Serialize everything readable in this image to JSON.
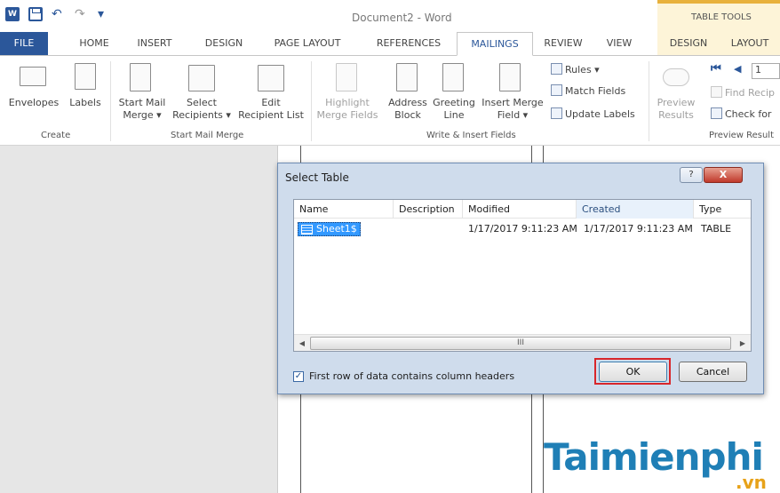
{
  "titlebar": {
    "doc_title": "Document2 - Word",
    "context_tab_header": "TABLE TOOLS"
  },
  "tabs": [
    {
      "label": "FILE"
    },
    {
      "label": "HOME"
    },
    {
      "label": "INSERT"
    },
    {
      "label": "DESIGN"
    },
    {
      "label": "PAGE LAYOUT"
    },
    {
      "label": "REFERENCES"
    },
    {
      "label": "MAILINGS"
    },
    {
      "label": "REVIEW"
    },
    {
      "label": "VIEW"
    },
    {
      "label": "DESIGN"
    },
    {
      "label": "LAYOUT"
    }
  ],
  "ribbon": {
    "create": {
      "label": "Create",
      "envelopes": "Envelopes",
      "labels": "Labels"
    },
    "start_mail_merge": {
      "label": "Start Mail Merge",
      "start_line1": "Start Mail",
      "start_line2": "Merge ▾",
      "select_line1": "Select",
      "select_line2": "Recipients ▾",
      "edit_line1": "Edit",
      "edit_line2": "Recipient List"
    },
    "write_insert": {
      "label": "Write & Insert Fields",
      "highlight_line1": "Highlight",
      "highlight_line2": "Merge Fields",
      "address_line1": "Address",
      "address_line2": "Block",
      "greeting_line1": "Greeting",
      "greeting_line2": "Line",
      "insert_line1": "Insert Merge",
      "insert_line2": "Field ▾",
      "rules": "Rules ▾",
      "match_fields": "Match Fields",
      "update_labels": "Update Labels"
    },
    "preview": {
      "label": "Preview Result",
      "preview_line1": "Preview",
      "preview_line2": "Results",
      "record_value": "1",
      "find_recipient": "Find Recip",
      "check_for": "Check for"
    }
  },
  "dialog": {
    "title": "Select Table",
    "help": "?",
    "close": "X",
    "columns": [
      "Name",
      "Description",
      "Modified",
      "Created",
      "Type"
    ],
    "rows": [
      {
        "name": "Sheet1$",
        "description": "",
        "modified": "1/17/2017 9:11:23 AM",
        "created": "1/17/2017 9:11:23 AM",
        "type": "TABLE"
      }
    ],
    "scroll_thumb": "III",
    "checkbox_label": "First row of data contains column headers",
    "checkbox_checked": "✓",
    "ok": "OK",
    "cancel": "Cancel"
  },
  "watermark": {
    "main": "Taimienphi",
    "sub": ".vn"
  },
  "colors": {
    "accent": "#2b579a",
    "highlight": "#d8262b",
    "selection": "#3399ff"
  }
}
